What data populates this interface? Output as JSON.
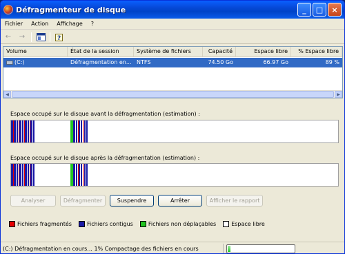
{
  "window": {
    "title": "Défragmenteur de disque"
  },
  "menu": [
    "Fichier",
    "Action",
    "Affichage",
    "?"
  ],
  "toolbar": {
    "icons": [
      "back-icon",
      "forward-icon",
      "view-icon",
      "help-icon"
    ]
  },
  "volumes": {
    "columns": [
      "Volume",
      "État de la session",
      "Système de fichiers",
      "Capacité",
      "Espace libre",
      "% Espace libre"
    ],
    "rows": [
      {
        "volume": "(C:)",
        "state": "Défragmentation en...",
        "fs": "NTFS",
        "capacity": "74.50 Go",
        "free": "66.97 Go",
        "pct_free": "89 %"
      }
    ]
  },
  "analysis": {
    "before_label": "Espace occupé sur le disque avant la défragmentation (estimation) :",
    "after_label": "Espace occupé sur le disque après la défragmentation (estimation) :"
  },
  "buttons": {
    "analyze": "Analyser",
    "defrag": "Défragmenter",
    "pause": "Suspendre",
    "stop": "Arrêter",
    "report": "Afficher le rapport"
  },
  "legend": {
    "fragmented": "Fichiers fragmentés",
    "contiguous": "Fichiers contigus",
    "unmovable": "Fichiers non déplaçables",
    "free": "Espace libre"
  },
  "colors": {
    "fragmented": "#e60000",
    "contiguous": "#1a1aa6",
    "unmovable": "#22c422",
    "free": "#ffffff"
  },
  "status": {
    "text": "(C:) Défragmentation en cours... 1%  Compactage des fichiers en cours",
    "progress": 0.01
  }
}
